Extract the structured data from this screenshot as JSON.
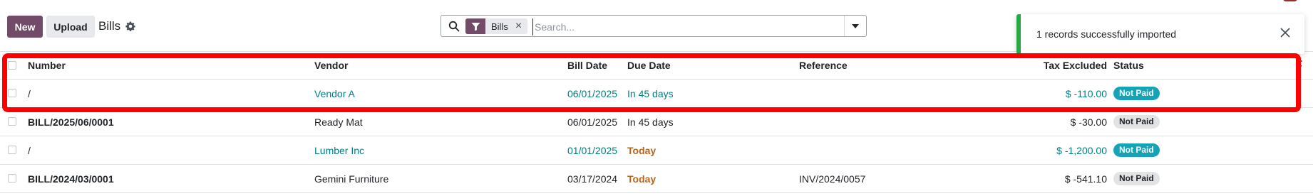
{
  "toolbar": {
    "new_label": "New",
    "upload_label": "Upload",
    "title": "Bills"
  },
  "search": {
    "facet_label": "Bills",
    "facet_remove": "×",
    "placeholder": "Search...",
    "value": ""
  },
  "notification": {
    "message": "1 records successfully imported"
  },
  "table": {
    "headers": {
      "number": "Number",
      "vendor": "Vendor",
      "bill_date": "Bill Date",
      "due_date": "Due Date",
      "reference": "Reference",
      "tax_excluded": "Tax Excluded",
      "status": "Status"
    },
    "rows": [
      {
        "number": "/",
        "vendor": "Vendor A",
        "bill_date": "06/01/2025",
        "due_date": "In 45 days",
        "reference": "",
        "tax_excluded": "$ -110.00",
        "status": "Not Paid"
      },
      {
        "number": "BILL/2025/06/0001",
        "vendor": "Ready Mat",
        "bill_date": "06/01/2025",
        "due_date": "In 45 days",
        "reference": "",
        "tax_excluded": "$ -30.00",
        "status": "Not Paid"
      },
      {
        "number": "/",
        "vendor": "Lumber Inc",
        "bill_date": "01/01/2025",
        "due_date": "Today",
        "reference": "",
        "tax_excluded": "$ -1,200.00",
        "status": "Not Paid"
      },
      {
        "number": "BILL/2024/03/0001",
        "vendor": "Gemini Furniture",
        "bill_date": "03/17/2024",
        "due_date": "Today",
        "reference": "INV/2024/0057",
        "tax_excluded": "$ -541.10",
        "status": "Not Paid"
      }
    ]
  },
  "colors": {
    "primary": "#714b67",
    "link": "#017e84",
    "badge_info": "#17a2b8",
    "badge_muted": "#e2e3e5",
    "today": "#b5651d",
    "success": "#28a745",
    "highlight": "#ff0000"
  },
  "icons": {
    "settings": "gear-icon",
    "search": "search-icon",
    "filter": "filter-icon",
    "dropdown": "caret-down-icon",
    "close": "close-icon",
    "optional_columns": "column-toggle-icon"
  }
}
